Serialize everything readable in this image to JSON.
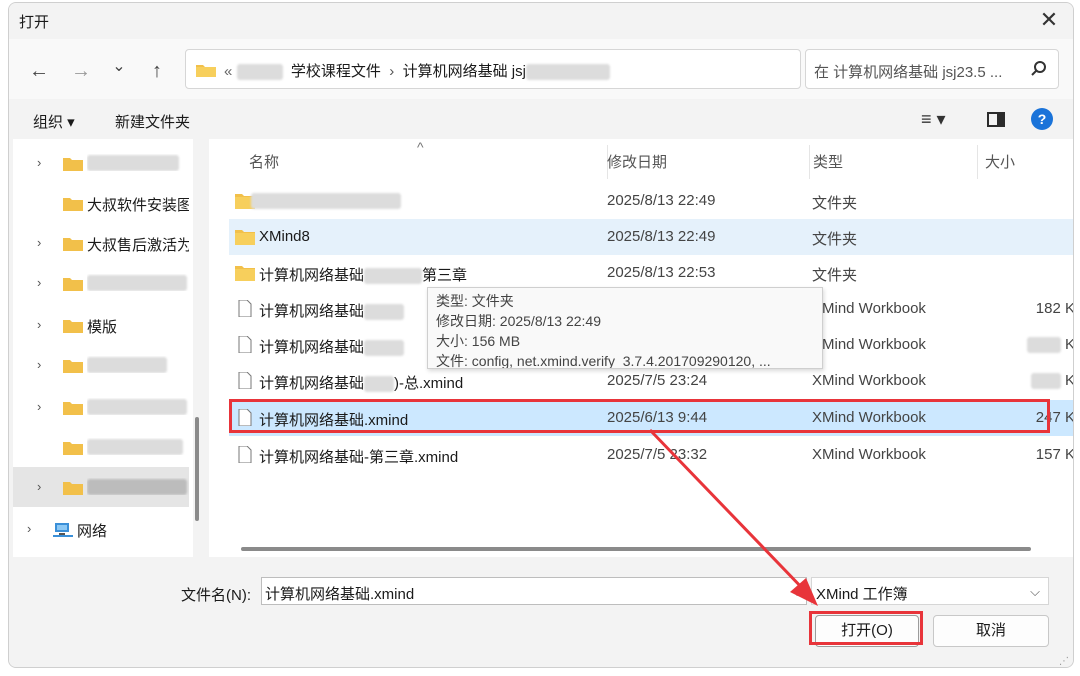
{
  "window": {
    "title": "打开",
    "close_icon": "close-icon"
  },
  "nav": {
    "back": "←",
    "forward": "→",
    "recent": "⌄",
    "up": "↑",
    "address_prefix": "«",
    "address_seg1": "学校课程文件",
    "address_sep": "›",
    "address_seg2": "计算机网络基础 jsj",
    "refresh": "↻",
    "search_placeholder": "在 计算机网络基础 jsj23.5 ..."
  },
  "toolbar": {
    "organize": "组织 ▾",
    "new_folder": "新建文件夹",
    "view": "≡ ▾",
    "help": "?"
  },
  "sidebar": {
    "items": [
      {
        "label": "",
        "arrow": "›",
        "redacted": true
      },
      {
        "label": "大叔软件安装图",
        "arrow": ""
      },
      {
        "label": "大叔售后激活为",
        "arrow": "›"
      },
      {
        "label": "",
        "arrow": "›",
        "redacted": true
      },
      {
        "label": "模版",
        "arrow": "›"
      },
      {
        "label": "",
        "arrow": "›",
        "redacted": true
      },
      {
        "label": "",
        "arrow": "›",
        "redacted": true
      },
      {
        "label": "",
        "arrow": "",
        "redacted": true
      },
      {
        "label": "",
        "arrow": "›",
        "redacted": true
      },
      {
        "label": "网络",
        "arrow": "›"
      }
    ]
  },
  "columns": {
    "name": "名称",
    "date": "修改日期",
    "type": "类型",
    "size": "大小"
  },
  "files": [
    {
      "name": "",
      "date": "2025/8/13 22:49",
      "type": "文件夹",
      "size": "",
      "kind": "folder"
    },
    {
      "name": "XMind8",
      "date": "2025/8/13 22:49",
      "type": "文件夹",
      "size": "",
      "kind": "folder"
    },
    {
      "name": "计算机网络基础",
      "name_suffix": "第三章",
      "date": "2025/8/13 22:53",
      "type": "文件夹",
      "size": "",
      "kind": "folder"
    },
    {
      "name": "计算机网络基础",
      "date": "",
      "type": "XMind Workbook",
      "size": "182 K",
      "kind": "file"
    },
    {
      "name": "计算机网络基础",
      "date": "",
      "type": "XMind Workbook",
      "size": "K",
      "kind": "file"
    },
    {
      "name": "计算机网络基础",
      "name_suffix": ")-总.xmind",
      "date": "2025/7/5 23:24",
      "type": "XMind Workbook",
      "size": "K",
      "kind": "file"
    },
    {
      "name": "计算机网络基础.xmind",
      "date": "2025/6/13 9:44",
      "type": "XMind Workbook",
      "size": "247 K",
      "kind": "file"
    },
    {
      "name": "计算机网络基础-第三章.xmind",
      "date": "2025/7/5 23:32",
      "type": "XMind Workbook",
      "size": "157 K",
      "kind": "file"
    }
  ],
  "tooltip": {
    "line1": "类型: 文件夹",
    "line2": "修改日期: 2025/8/13 22:49",
    "line3": "大小: 156 MB",
    "line4": "文件: config, net.xmind.verify_3.7.4.201709290120, ..."
  },
  "bottom": {
    "filename_label": "文件名(N):",
    "filename_value": "计算机网络基础.xmind",
    "filetype_value": "XMind 工作簿",
    "open_label": "打开(O)",
    "cancel_label": "取消"
  },
  "colors": {
    "accent": "#1a73d9",
    "highlight": "#e8343a",
    "folder": "#f2c04a",
    "selected_row": "#cce8ff"
  }
}
